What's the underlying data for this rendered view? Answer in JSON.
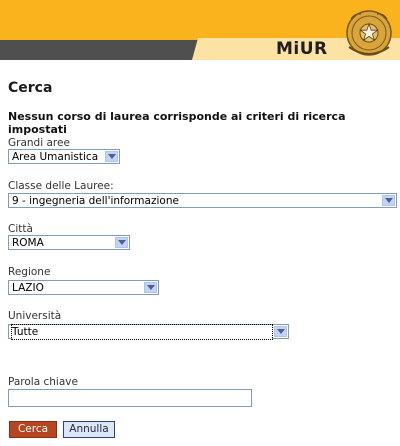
{
  "header": {
    "brand": "MiUR",
    "emblem_icon": "italian-republic-emblem-icon",
    "colors": {
      "bar": "#fbb31d",
      "dark_band": "#4f4f4f",
      "light_band": "#fde3a3"
    }
  },
  "page": {
    "title": "Cerca",
    "notice": "Nessun corso di laurea corrisponde ai criteri di ricerca impostati"
  },
  "form": {
    "grandi_aree": {
      "label": "Grandi aree",
      "value": "Area Umanistica"
    },
    "classe": {
      "label": "Classe delle Lauree:",
      "value": "9 - ingegneria dell'informazione"
    },
    "citta": {
      "label": "Città",
      "value": "ROMA"
    },
    "regione": {
      "label": "Regione",
      "value": "LAZIO"
    },
    "universita": {
      "label": "Università",
      "value": "Tutte"
    },
    "parola_chiave": {
      "label": "Parola chiave",
      "value": ""
    }
  },
  "buttons": {
    "cerca": "Cerca",
    "annulla": "Annulla"
  }
}
